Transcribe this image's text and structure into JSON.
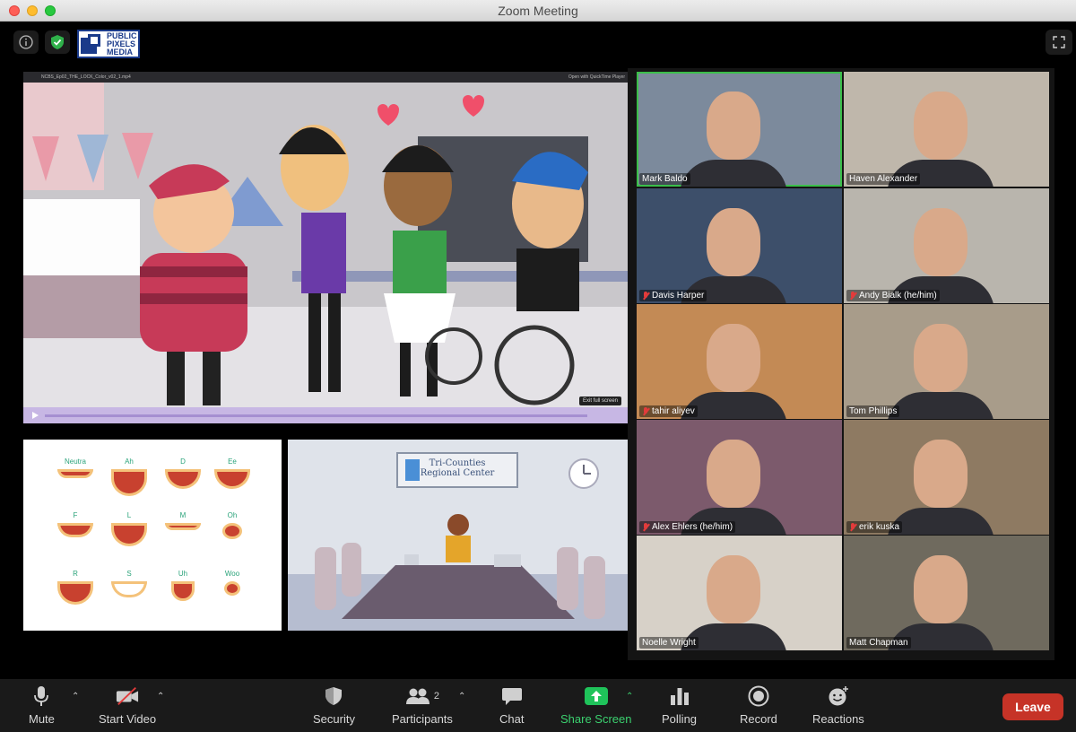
{
  "window": {
    "title": "Zoom Meeting"
  },
  "topbar": {
    "logo_text": [
      "PUBLIC",
      "PIXELS",
      "MEDIA"
    ]
  },
  "share": {
    "filename": "NCBS_Ep02_THE_LOCK_Color_v02_1.mp4",
    "open_with": "Open with QuickTime Player",
    "exit_fullscreen": "Exit full screen",
    "timecode": "0:00"
  },
  "mouth_chart": {
    "labels": [
      "Neutra",
      "Ah",
      "D",
      "Ee",
      "F",
      "L",
      "M",
      "Oh",
      "R",
      "S",
      "Uh",
      "Woo"
    ]
  },
  "boardroom": {
    "sign_line1": "Tri-Counties",
    "sign_line2": "Regional Center"
  },
  "participants": [
    {
      "name": "Mark Baldo",
      "muted": false,
      "active": true,
      "bg": "#7c8a9c"
    },
    {
      "name": "Haven Alexander",
      "muted": false,
      "active": false,
      "bg": "#bfb7ab"
    },
    {
      "name": "Davis Harper",
      "muted": true,
      "active": false,
      "bg": "#3d4f6a"
    },
    {
      "name": "Andy Bialk (he/him)",
      "muted": true,
      "active": false,
      "bg": "#b9b5ad"
    },
    {
      "name": "tahir aliyev",
      "muted": true,
      "active": false,
      "bg": "#c38a55"
    },
    {
      "name": "Tom Phillips",
      "muted": false,
      "active": false,
      "bg": "#a89c8a"
    },
    {
      "name": "Alex Ehlers (he/him)",
      "muted": true,
      "active": false,
      "bg": "#7c5a6c"
    },
    {
      "name": "erik kuska",
      "muted": true,
      "active": false,
      "bg": "#8e7a62"
    },
    {
      "name": "Noelle Wright",
      "muted": false,
      "active": false,
      "bg": "#d7d1c8"
    },
    {
      "name": "Matt Chapman",
      "muted": false,
      "active": false,
      "bg": "#6f6a5e"
    }
  ],
  "toolbar": {
    "mute": "Mute",
    "start_video": "Start Video",
    "security": "Security",
    "participants": "Participants",
    "participants_count": "2",
    "chat": "Chat",
    "share_screen": "Share Screen",
    "polling": "Polling",
    "record": "Record",
    "reactions": "Reactions",
    "leave": "Leave"
  },
  "colors": {
    "accent_green": "#3bd16f",
    "leave_red": "#c63327",
    "active_border": "#3bbf4a"
  }
}
